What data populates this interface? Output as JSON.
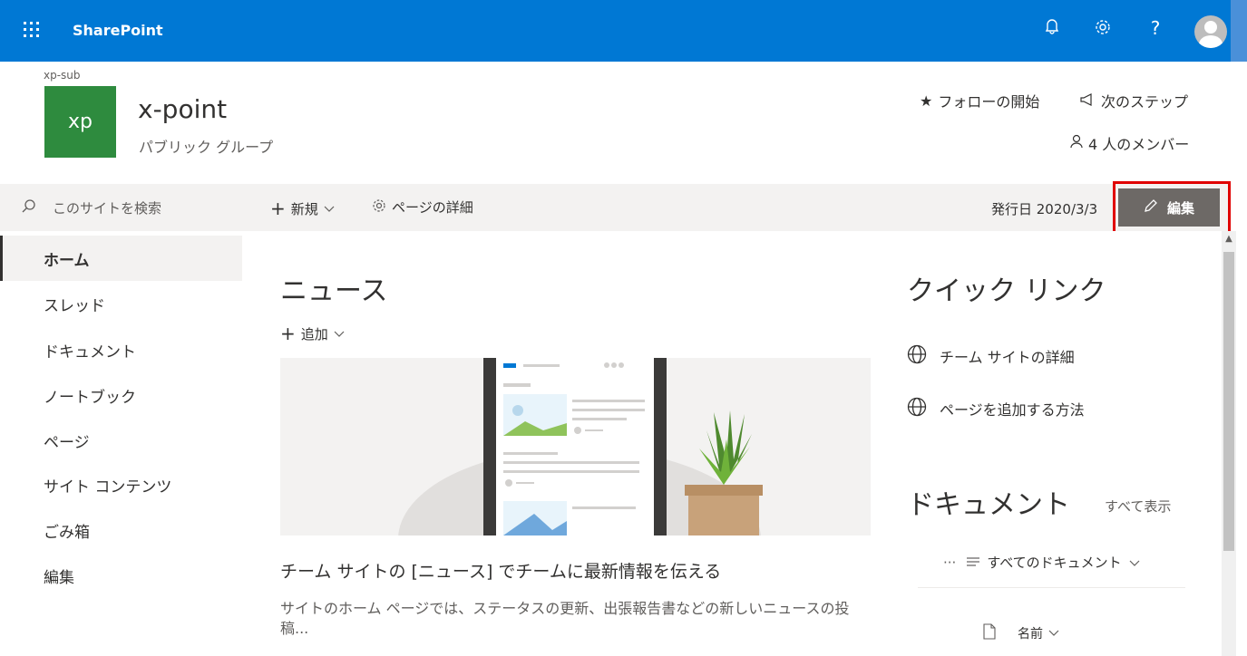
{
  "suitebar": {
    "app_name": "SharePoint",
    "icons": [
      "waffle-icon",
      "bell-icon",
      "settings-icon",
      "help-icon",
      "avatar"
    ],
    "help_glyph": "?",
    "color": "#0078d4"
  },
  "site": {
    "subsite": "xp-sub",
    "logo_text": "xp",
    "title": "x-point",
    "subtitle": "パブリック グループ",
    "follow": "フォローの開始",
    "next_steps": "次のステップ",
    "members": "4 人のメンバー",
    "logo_color": "#2e8b3e"
  },
  "search": {
    "placeholder": "このサイトを検索"
  },
  "commandbar": {
    "new_label": "新規",
    "page_details": "ページの詳細",
    "published": "発行日 2020/3/3",
    "edit_label": "編集"
  },
  "nav": {
    "items": [
      {
        "label": "ホーム",
        "active": true
      },
      {
        "label": "スレッド"
      },
      {
        "label": "ドキュメント"
      },
      {
        "label": "ノートブック"
      },
      {
        "label": "ページ"
      },
      {
        "label": "サイト コンテンツ"
      },
      {
        "label": "ごみ箱"
      },
      {
        "label": "編集"
      }
    ]
  },
  "news": {
    "title": "ニュース",
    "add_label": "追加",
    "headline": "チーム サイトの [ニュース] でチームに最新情報を伝える",
    "description": "サイトのホーム ページでは、ステータスの更新、出張報告書などの新しいニュースの投稿..."
  },
  "quicklinks": {
    "title": "クイック リンク",
    "items": [
      "チーム サイトの詳細",
      "ページを追加する方法"
    ]
  },
  "documents": {
    "title": "ドキュメント",
    "see_all": "すべて表示",
    "more": "···",
    "view_label": "すべてのドキュメント",
    "column_name": "名前"
  }
}
